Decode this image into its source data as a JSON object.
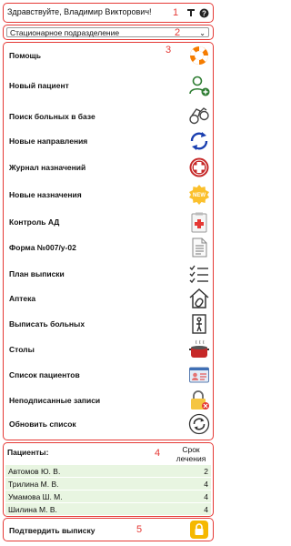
{
  "header": {
    "greeting": "Здравствуйте, Владимир Викторович!",
    "marker": "1"
  },
  "department": {
    "selected": "Стационарное подразделение",
    "marker": "2"
  },
  "menu": {
    "marker": "3",
    "items": [
      {
        "label": "Помощь",
        "icon": "lifebuoy-icon"
      },
      {
        "label": "Новый пациент",
        "icon": "add-person-icon"
      },
      {
        "label": "Поиск больных в базе",
        "icon": "binoculars-icon"
      },
      {
        "label": "Новые направления",
        "icon": "refresh-circle-icon"
      },
      {
        "label": "Журнал назначений",
        "icon": "medical-plus-icon"
      },
      {
        "label": "Новые назначения",
        "icon": "new-badge-icon"
      },
      {
        "label": "Контроль АД",
        "icon": "medical-chart-icon"
      },
      {
        "label": "Форма №007/у-02",
        "icon": "form-document-icon"
      },
      {
        "label": "План выписки",
        "icon": "checklist-icon"
      },
      {
        "label": "Аптека",
        "icon": "pharmacy-house-icon"
      },
      {
        "label": "Выписать больных",
        "icon": "exit-door-icon"
      },
      {
        "label": "Столы",
        "icon": "cooking-pot-icon"
      },
      {
        "label": "Список пациентов",
        "icon": "id-card-icon"
      },
      {
        "label": "Неподписанные записи",
        "icon": "unsigned-lock-icon"
      },
      {
        "label": "Обновить список",
        "icon": "reload-icon"
      }
    ]
  },
  "patients": {
    "marker": "4",
    "title": "Пациенты:",
    "col_stay": "Срок\nлечения",
    "rows": [
      {
        "name": "Автомов Ю. В.",
        "days": "2"
      },
      {
        "name": "Трилина М. В.",
        "days": "4"
      },
      {
        "name": "Умамова Ш. М.",
        "days": "4"
      },
      {
        "name": "Шилина М. В.",
        "days": "4"
      }
    ]
  },
  "confirm": {
    "label": "Подтвердить выписку",
    "marker": "5"
  },
  "colors": {
    "marker": "#e53935",
    "row_bg": "#e8f5e1",
    "lock": "#f5b800"
  }
}
